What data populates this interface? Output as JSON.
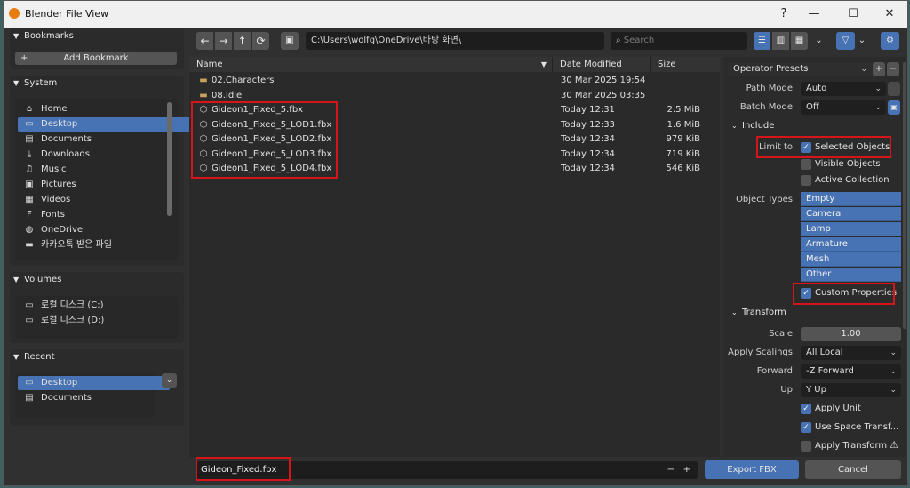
{
  "window": {
    "title": "Blender File View",
    "controls": {
      "help": "?",
      "minimize": "—",
      "maximize": "☐",
      "close": "✕"
    }
  },
  "sidebar": {
    "bookmarks": {
      "header": "Bookmarks",
      "add_label": "Add Bookmark"
    },
    "system": {
      "header": "System",
      "items": [
        {
          "label": "Home",
          "icon": "home-icon",
          "glyph": "⌂"
        },
        {
          "label": "Desktop",
          "icon": "desktop-icon",
          "glyph": "▭"
        },
        {
          "label": "Documents",
          "icon": "documents-icon",
          "glyph": "▤"
        },
        {
          "label": "Downloads",
          "icon": "download-icon",
          "glyph": "⤓"
        },
        {
          "label": "Music",
          "icon": "music-icon",
          "glyph": "♫"
        },
        {
          "label": "Pictures",
          "icon": "pictures-icon",
          "glyph": "▣"
        },
        {
          "label": "Videos",
          "icon": "videos-icon",
          "glyph": "▦"
        },
        {
          "label": "Fonts",
          "icon": "fonts-icon",
          "glyph": "F"
        },
        {
          "label": "OneDrive",
          "icon": "globe-icon",
          "glyph": "◍"
        },
        {
          "label": "카카오톡 받은 파일",
          "icon": "folder-icon",
          "glyph": "▬"
        }
      ],
      "selected_index": 1
    },
    "volumes": {
      "header": "Volumes",
      "items": [
        {
          "label": "로컬 디스크 (C:)",
          "icon": "disk-icon",
          "glyph": "▭"
        },
        {
          "label": "로컬 디스크 (D:)",
          "icon": "disk-icon",
          "glyph": "▭"
        }
      ]
    },
    "recent": {
      "header": "Recent",
      "items": [
        {
          "label": "Desktop",
          "icon": "desktop-icon",
          "glyph": "▭"
        },
        {
          "label": "Documents",
          "icon": "documents-icon",
          "glyph": "▤"
        }
      ],
      "selected_index": 0
    }
  },
  "toolbar": {
    "path": "C:\\Users\\wolfg\\OneDrive\\바탕 화면\\",
    "search_placeholder": "Search"
  },
  "file_list": {
    "columns": {
      "name": "Name",
      "date": "Date Modified",
      "size": "Size"
    },
    "rows": [
      {
        "name": "02.Characters",
        "date": "30 Mar 2025 19:54",
        "size": "",
        "type": "folder"
      },
      {
        "name": "08.Idle",
        "date": "30 Mar 2025 03:35",
        "size": "",
        "type": "folder"
      },
      {
        "name": "Gideon1_Fixed_5.fbx",
        "date": "Today 12:31",
        "size": "2.5 MiB",
        "type": "file"
      },
      {
        "name": "Gideon1_Fixed_5_LOD1.fbx",
        "date": "Today 12:33",
        "size": "1.6 MiB",
        "type": "file"
      },
      {
        "name": "Gideon1_Fixed_5_LOD2.fbx",
        "date": "Today 12:34",
        "size": "979 KiB",
        "type": "file"
      },
      {
        "name": "Gideon1_Fixed_5_LOD3.fbx",
        "date": "Today 12:34",
        "size": "719 KiB",
        "type": "file"
      },
      {
        "name": "Gideon1_Fixed_5_LOD4.fbx",
        "date": "Today 12:34",
        "size": "546 KiB",
        "type": "file"
      }
    ]
  },
  "bottom": {
    "filename": "Gideon_Fixed.fbx",
    "minus": "−",
    "plus": "+",
    "export_label": "Export FBX",
    "cancel_label": "Cancel"
  },
  "options": {
    "operator_presets": "Operator Presets",
    "path_mode": {
      "label": "Path Mode",
      "value": "Auto"
    },
    "batch_mode": {
      "label": "Batch Mode",
      "value": "Off"
    },
    "include": {
      "header": "Include",
      "limit_to_label": "Limit to",
      "selected_objects": {
        "label": "Selected Objects",
        "checked": true
      },
      "visible_objects": {
        "label": "Visible Objects",
        "checked": false
      },
      "active_collection": {
        "label": "Active Collection",
        "checked": false
      },
      "object_types_label": "Object Types",
      "object_types": [
        "Empty",
        "Camera",
        "Lamp",
        "Armature",
        "Mesh",
        "Other"
      ],
      "custom_properties": {
        "label": "Custom Properties",
        "checked": true
      }
    },
    "transform": {
      "header": "Transform",
      "scale": {
        "label": "Scale",
        "value": "1.00"
      },
      "apply_scalings": {
        "label": "Apply Scalings",
        "value": "All Local"
      },
      "forward": {
        "label": "Forward",
        "value": "-Z Forward"
      },
      "up": {
        "label": "Up",
        "value": "Y Up"
      },
      "apply_unit": {
        "label": "Apply Unit",
        "checked": true
      },
      "use_space_transform": {
        "label": "Use Space Transf...",
        "checked": true
      },
      "apply_transform": {
        "label": "Apply Transform",
        "checked": false
      }
    }
  },
  "colors": {
    "selection": "#4772b3",
    "highlight_box": "#d7141a"
  }
}
